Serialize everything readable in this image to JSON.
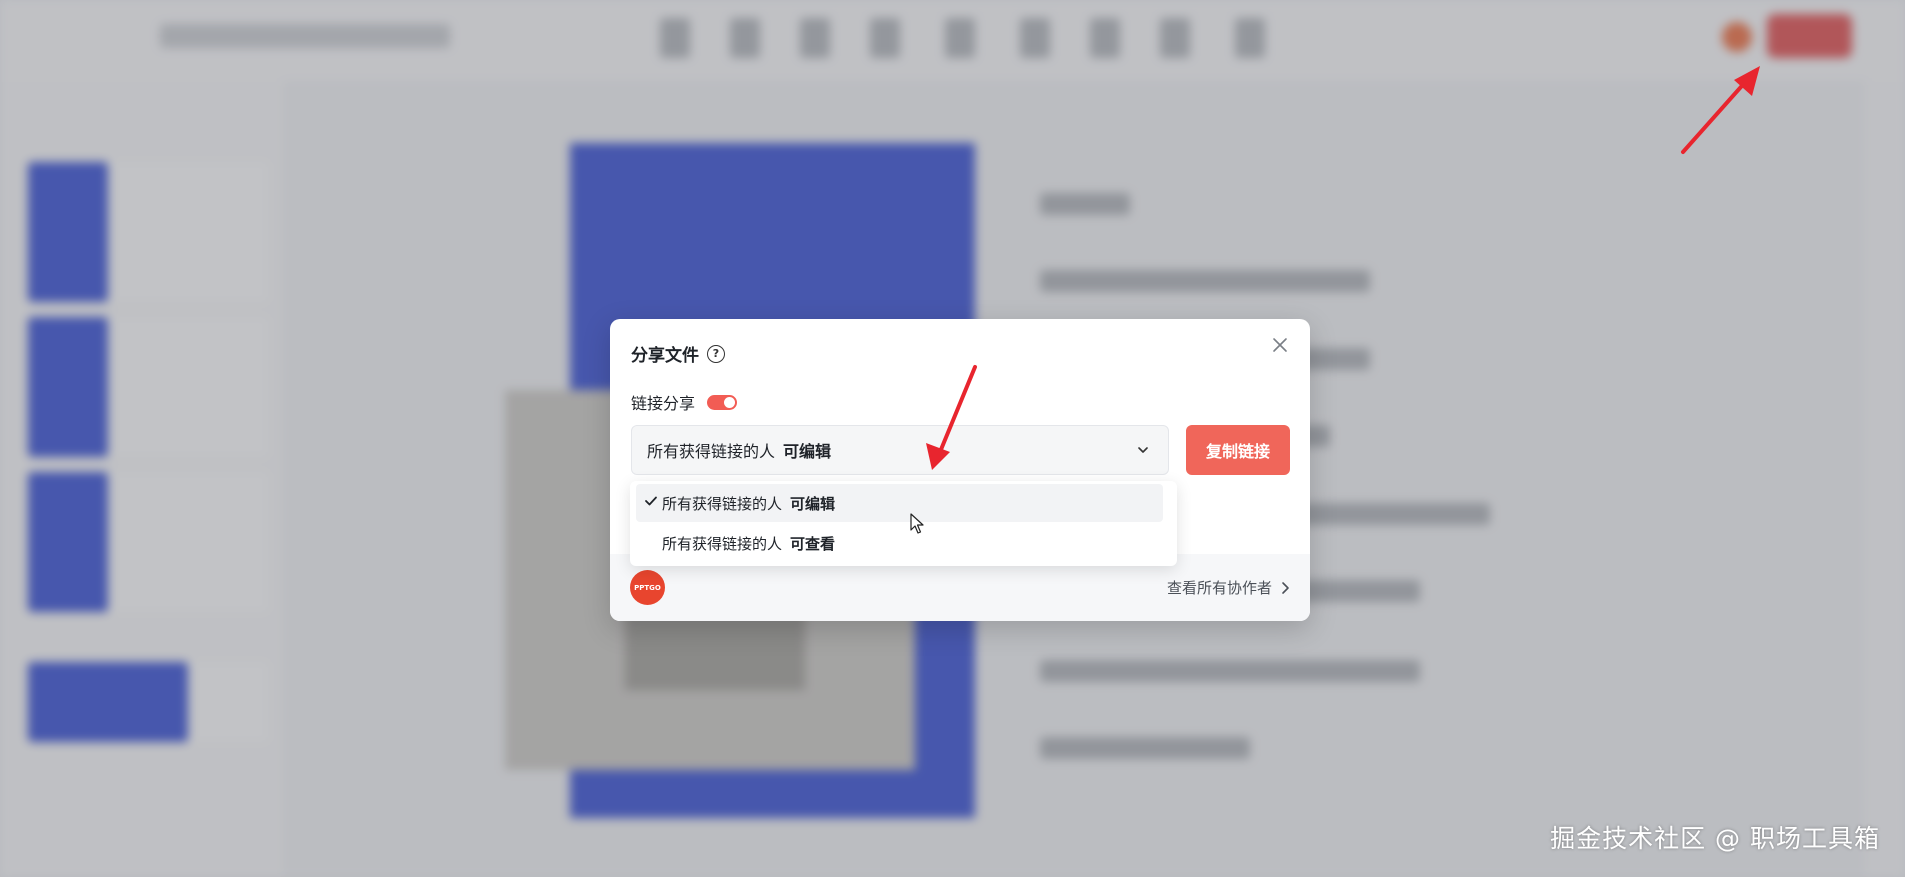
{
  "dialog": {
    "title": "分享文件",
    "link_share_label": "链接分享",
    "link_share_enabled": true,
    "permission_prefix": "所有获得链接的人",
    "permission_selected": "可编辑",
    "copy_button": "复制链接",
    "view_collaborators": "查看所有协作者",
    "avatar_text": "PPTGO"
  },
  "menu": {
    "options": [
      {
        "prefix": "所有获得链接的人",
        "value": "可编辑",
        "checked": true
      },
      {
        "prefix": "所有获得链接的人",
        "value": "可查看",
        "checked": false
      }
    ]
  },
  "watermark": "掘金技术社区 @ 职场工具箱",
  "colors": {
    "accent": "#f0665a",
    "annotation_arrow": "#e8252e",
    "background_blue": "#1f3bd1"
  }
}
